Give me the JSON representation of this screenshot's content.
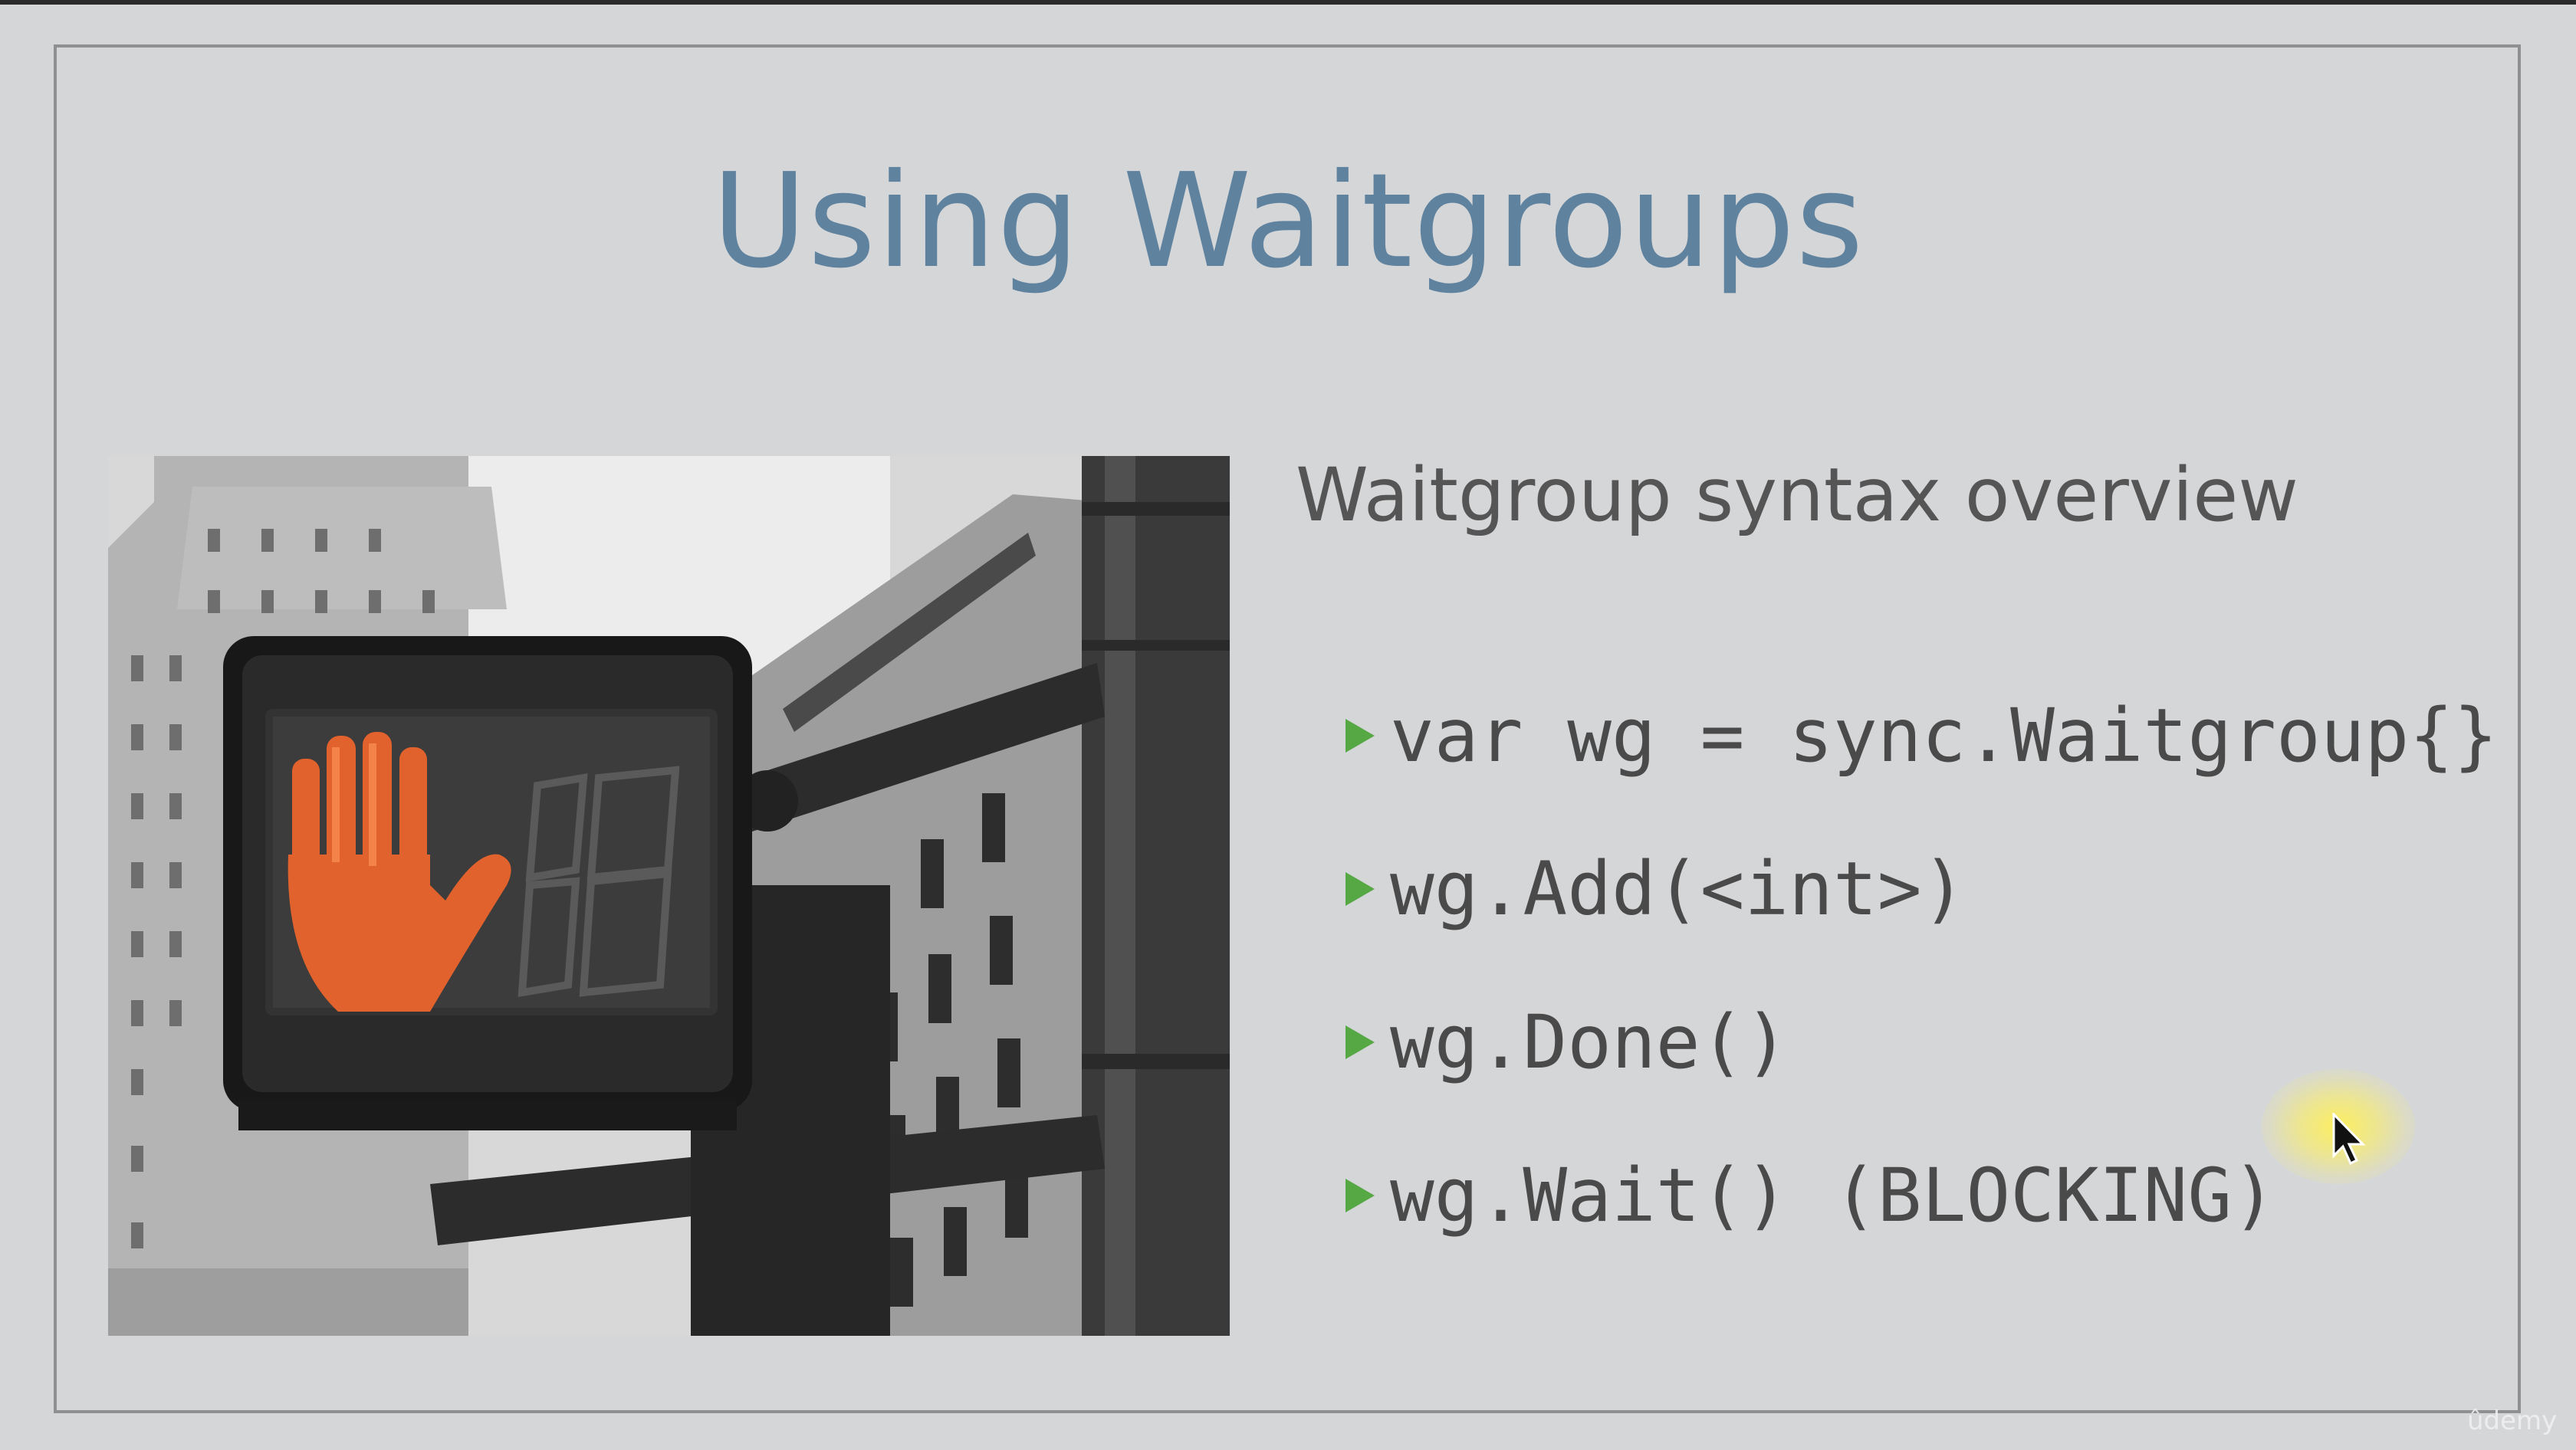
{
  "slide": {
    "title": "Using Waitgroups",
    "subtitle": "Waitgroup syntax overview",
    "bullets": [
      "var wg = sync.Waitgroup{}",
      "wg.Add(<int>)",
      "wg.Done()",
      "wg.Wait() (BLOCKING)"
    ],
    "image_subject": "pedestrian crossing signal showing red hand, city buildings in black and white"
  },
  "watermark": "ûdemy",
  "colors": {
    "title": "#5f829f",
    "bullet_marker": "#56a845",
    "text": "#4a4a4a",
    "background": "#d5d6d8",
    "signal_hand": "#e1622c"
  },
  "icons": {
    "bullet_marker": "play-triangle-icon",
    "pointer": "mouse-cursor-icon"
  }
}
